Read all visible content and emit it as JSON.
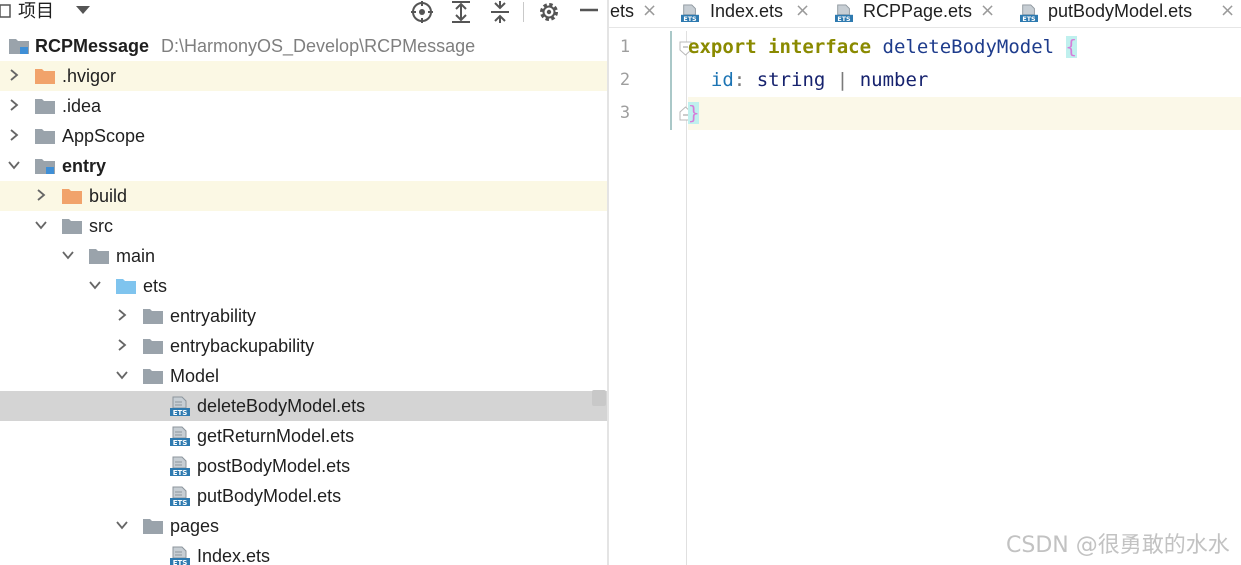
{
  "panel_header": {
    "title": "项目",
    "icons": [
      "locate-icon",
      "expand-all-icon",
      "collapse-all-icon",
      "settings-icon",
      "hide-icon"
    ]
  },
  "tree": {
    "root": {
      "label": "RCPMessage",
      "path": "D:\\HarmonyOS_Develop\\RCPMessage"
    },
    "items": [
      {
        "label": ".hvigor",
        "state": "collapsed",
        "icon": "folder-orange-icon"
      },
      {
        "label": ".idea",
        "state": "collapsed",
        "icon": "folder-icon"
      },
      {
        "label": "AppScope",
        "state": "collapsed",
        "icon": "folder-icon"
      },
      {
        "label": "entry",
        "state": "expanded",
        "icon": "module-folder-icon"
      },
      {
        "label": "build",
        "state": "collapsed",
        "icon": "folder-orange-icon"
      },
      {
        "label": "src",
        "state": "expanded",
        "icon": "folder-icon"
      },
      {
        "label": "main",
        "state": "expanded",
        "icon": "folder-icon"
      },
      {
        "label": "ets",
        "state": "expanded",
        "icon": "folder-blue-icon"
      },
      {
        "label": "entryability",
        "state": "collapsed",
        "icon": "folder-icon"
      },
      {
        "label": "entrybackupability",
        "state": "collapsed",
        "icon": "folder-icon"
      },
      {
        "label": "Model",
        "state": "expanded",
        "icon": "folder-icon"
      },
      {
        "label": "deleteBodyModel.ets",
        "icon": "ets-file-icon"
      },
      {
        "label": "getReturnModel.ets",
        "icon": "ets-file-icon"
      },
      {
        "label": "postBodyModel.ets",
        "icon": "ets-file-icon"
      },
      {
        "label": "putBodyModel.ets",
        "icon": "ets-file-icon"
      },
      {
        "label": "pages",
        "state": "expanded",
        "icon": "folder-icon"
      },
      {
        "label": "Index.ets",
        "icon": "ets-file-icon"
      }
    ]
  },
  "tabs": [
    {
      "label": "ets",
      "close": "×"
    },
    {
      "label": "Index.ets",
      "close": "×"
    },
    {
      "label": "RCPPage.ets",
      "close": "×"
    },
    {
      "label": "putBodyModel.ets",
      "close": "×"
    }
  ],
  "editor": {
    "line_numbers": [
      "1",
      "2",
      "3"
    ],
    "code": {
      "line1": {
        "kw1": "export",
        "kw2": "interface",
        "name": "deleteBodyModel",
        "brace": "{"
      },
      "line2": {
        "field": "id",
        "colon": ":",
        "type1": "string",
        "pipe": "|",
        "type2": "number"
      },
      "line3": {
        "brace": "}"
      }
    }
  },
  "watermark": "CSDN @很勇敢的水水",
  "colors": {
    "keyword": "#8a8a00",
    "interface_name": "#1e3c8c",
    "field": "#1c74b4",
    "type": "#16226e",
    "brace": "#d67cd8",
    "current_line": "#fbf8e8",
    "selected_row": "#d4d4d4",
    "folder": "#9aa3ab",
    "folder_orange": "#f1a36b",
    "folder_blue": "#7fc4ee"
  }
}
